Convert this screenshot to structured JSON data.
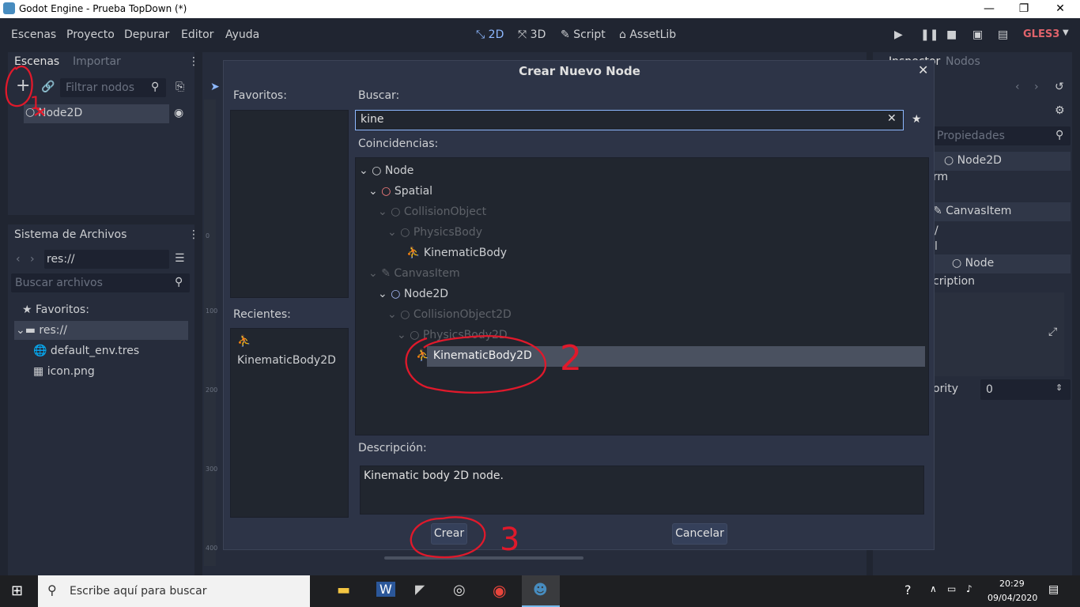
{
  "window": {
    "title": "Godot Engine - Prueba TopDown (*)",
    "minimize": "—",
    "maximize": "❐",
    "close": "✕"
  },
  "menu": {
    "items": [
      "Escenas",
      "Proyecto",
      "Depurar",
      "Editor",
      "Ayuda"
    ]
  },
  "modes": {
    "items": [
      "2D",
      "3D",
      "Script",
      "AssetLib"
    ],
    "active": "2D",
    "renderer": "GLES3"
  },
  "scene_dock": {
    "tabs": [
      "Escenas",
      "Importar"
    ],
    "filter_placeholder": "Filtrar nodos",
    "root_node": "Node2D"
  },
  "filesystem": {
    "title": "Sistema de Archivos",
    "path": "res://",
    "search_placeholder": "Buscar archivos",
    "items": [
      "Favoritos:",
      "res://",
      "default_env.tres",
      "icon.png"
    ]
  },
  "inspector": {
    "tabs": [
      "Inspector",
      "Nodos"
    ],
    "filter_placeholder": "Propiedades",
    "rows": [
      "Node2D",
      "rm",
      "CanvasItem",
      "/",
      "l",
      "Node",
      "cription",
      "ority",
      "0"
    ]
  },
  "ruler": {
    "marks": [
      "0",
      "100",
      "200",
      "300",
      "400"
    ]
  },
  "dialog": {
    "title": "Crear Nuevo Node",
    "favorites_label": "Favoritos:",
    "recents_label": "Recientes:",
    "recents": [
      "KinematicBody2D"
    ],
    "search_label": "Buscar:",
    "search_value": "kine",
    "matches_label": "Coincidencias:",
    "tree": [
      {
        "label": "Node",
        "indent": 0,
        "dim": false
      },
      {
        "label": "Spatial",
        "indent": 1,
        "dim": false
      },
      {
        "label": "CollisionObject",
        "indent": 2,
        "dim": true
      },
      {
        "label": "PhysicsBody",
        "indent": 3,
        "dim": true
      },
      {
        "label": "KinematicBody",
        "indent": 4,
        "dim": false
      },
      {
        "label": "CanvasItem",
        "indent": 1,
        "dim": true
      },
      {
        "label": "Node2D",
        "indent": 2,
        "dim": false
      },
      {
        "label": "CollisionObject2D",
        "indent": 3,
        "dim": true
      },
      {
        "label": "PhysicsBody2D",
        "indent": 4,
        "dim": true
      },
      {
        "label": "KinematicBody2D",
        "indent": 5,
        "dim": false,
        "selected": true
      }
    ],
    "description_label": "Descripción:",
    "description": "Kinematic body 2D node.",
    "create_button": "Crear",
    "cancel_button": "Cancelar"
  },
  "annotations": [
    "1",
    "2",
    "3"
  ],
  "taskbar": {
    "search_placeholder": "Escribe aquí para buscar",
    "time": "20:29",
    "date": "09/04/2020"
  },
  "colors": {
    "bg": "#202531",
    "panel": "#262c3b",
    "dialog": "#2d3447",
    "accent": "#8db8ff",
    "annotation": "#e0192b",
    "selected_row": "#4a5160"
  }
}
